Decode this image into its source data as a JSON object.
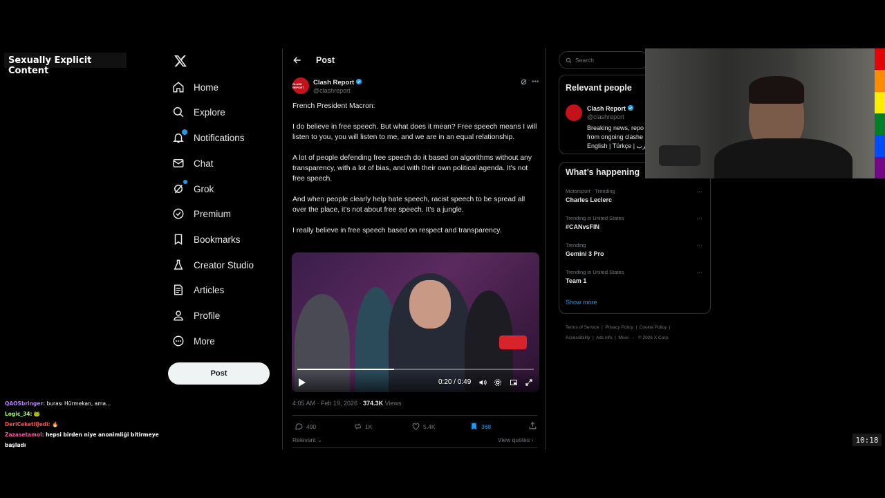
{
  "overlay": {
    "warning_label": "Sexually Explicit Content",
    "clock": "10:18"
  },
  "nav": {
    "items": [
      {
        "label": "Home",
        "icon": "home-icon"
      },
      {
        "label": "Explore",
        "icon": "search-icon"
      },
      {
        "label": "Notifications",
        "icon": "bell-icon"
      },
      {
        "label": "Chat",
        "icon": "mail-icon"
      },
      {
        "label": "Grok",
        "icon": "grok-icon"
      },
      {
        "label": "Premium",
        "icon": "premium-icon"
      },
      {
        "label": "Bookmarks",
        "icon": "bookmark-icon"
      },
      {
        "label": "Creator Studio",
        "icon": "flask-icon"
      },
      {
        "label": "Articles",
        "icon": "article-icon"
      },
      {
        "label": "Profile",
        "icon": "person-icon"
      },
      {
        "label": "More",
        "icon": "more-circle-icon"
      }
    ],
    "post_button": "Post"
  },
  "post": {
    "header_title": "Post",
    "author": {
      "name": "Clash Report",
      "handle": "@clashreport",
      "avatar_text": "CLASH REPORT"
    },
    "paragraphs": [
      "French President Macron:",
      "I do believe in free speech. But what does it mean? Free speech means I will listen to you, you will listen to me, and we are in an equal relationship.",
      "A lot of people defending free speech do it based on algorithms without any transparency, with a lot of bias, and with their own political agenda. It's not free speech.",
      "And when people clearly help hate speech, racist speech to be spread all over the place, it's not about free speech. It's a jungle.",
      "I really believe in free speech based on respect and transparency."
    ],
    "video": {
      "time": "0:20 / 0:49",
      "progress": 0.41
    },
    "timestamp": "4:05 AM · Feb 19, 2026 · ",
    "views_count": "374.3K",
    "views_label": " Views",
    "actions": {
      "replies": "490",
      "reposts": "1K",
      "likes": "5.4K",
      "bookmarks": "368"
    },
    "relevant_label": "Relevant",
    "view_quotes": "View quotes"
  },
  "sidebar": {
    "search_placeholder": "Search",
    "relevant_people_title": "Relevant people",
    "relevant_person": {
      "name": "Clash Report",
      "handle": "@clashreport",
      "bio_line1": "Breaking news, repo",
      "bio_line2": "from ongoing clashe",
      "bio_line3": "English | Türkçe | عرب"
    },
    "whats_happening_title": "What’s happening",
    "trends": [
      {
        "category": "Motorsport · Trending",
        "name": "Charles Leclerc"
      },
      {
        "category": "Trending in United States",
        "name": "#CANvsFIN"
      },
      {
        "category": "Trending",
        "name": "Gemini 3 Pro"
      },
      {
        "category": "Trending in United States",
        "name": "Team 1"
      }
    ],
    "show_more": "Show more",
    "footer": [
      "Terms of Service",
      "Privacy Policy",
      "Cookie Policy",
      "Accessibility",
      "Ads info",
      "More ···",
      "© 2026 X Corp."
    ]
  },
  "chat": [
    {
      "user": "QAOSbringer:",
      "msg": "burası Hürmekan, ama...",
      "color": "#b57cff"
    },
    {
      "user": "Logic_34:",
      "msg": "",
      "color": "#9cff5a"
    },
    {
      "user": "DeriCeketliJedi:",
      "msg": "",
      "color": "#ff4f4f"
    },
    {
      "user": "Zazasetamol:",
      "msg": "hepsi birden niye anonimliği bitirmeye başladı",
      "color": "#ff4fa3"
    }
  ],
  "colors": {
    "accent": "#1d9bf0",
    "brand_red": "#c4121a"
  }
}
